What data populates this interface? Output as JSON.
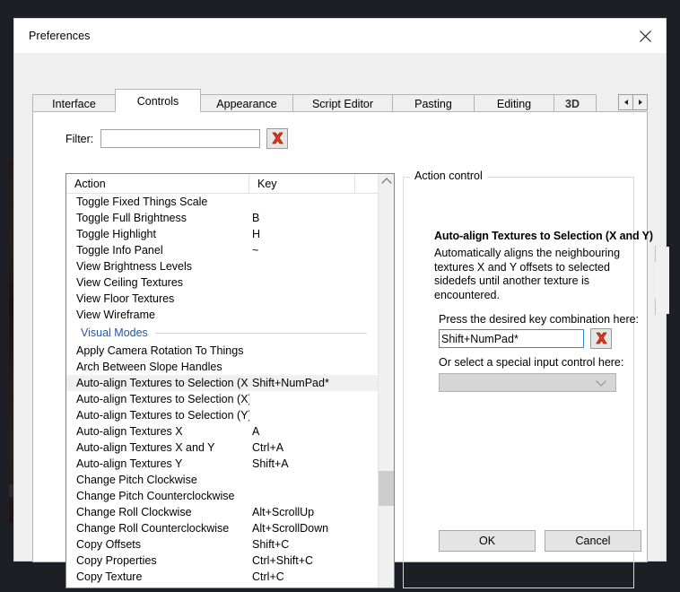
{
  "window": {
    "title": "Preferences",
    "close_icon": "close-x-icon"
  },
  "tabs": [
    {
      "label": "Interface",
      "active": false
    },
    {
      "label": "Controls",
      "active": true
    },
    {
      "label": "Appearance",
      "active": false
    },
    {
      "label": "Script Editor",
      "active": false
    },
    {
      "label": "Pasting",
      "active": false
    },
    {
      "label": "Editing",
      "active": false
    },
    {
      "label": "3D",
      "active": false
    }
  ],
  "tab_nav": {
    "prev_icon": "triangle-left-icon",
    "next_icon": "triangle-right-icon"
  },
  "filter": {
    "label": "Filter:",
    "value": "",
    "placeholder": "",
    "clear_icon": "red-x-clear-icon"
  },
  "list": {
    "columns": [
      "Action",
      "Key"
    ],
    "rows": [
      {
        "action": "Toggle Fixed Things Scale",
        "key": "",
        "type": "item",
        "selected": false
      },
      {
        "action": "Toggle Full Brightness",
        "key": "B",
        "type": "item",
        "selected": false
      },
      {
        "action": "Toggle Highlight",
        "key": "H",
        "type": "item",
        "selected": false
      },
      {
        "action": "Toggle Info Panel",
        "key": "~",
        "type": "item",
        "selected": false
      },
      {
        "action": "View Brightness Levels",
        "key": "",
        "type": "item",
        "selected": false
      },
      {
        "action": "View Ceiling Textures",
        "key": "",
        "type": "item",
        "selected": false
      },
      {
        "action": "View Floor Textures",
        "key": "",
        "type": "item",
        "selected": false
      },
      {
        "action": "View Wireframe",
        "key": "",
        "type": "item",
        "selected": false
      },
      {
        "action": "Visual Modes",
        "key": "",
        "type": "group",
        "selected": false
      },
      {
        "action": "Apply Camera Rotation To Things",
        "key": "",
        "type": "item",
        "selected": false
      },
      {
        "action": "Arch Between Slope Handles",
        "key": "",
        "type": "item",
        "selected": false
      },
      {
        "action": "Auto-align Textures to Selection (X an...",
        "key": "Shift+NumPad*",
        "type": "item",
        "selected": true
      },
      {
        "action": "Auto-align Textures to Selection (X)",
        "key": "",
        "type": "item",
        "selected": false
      },
      {
        "action": "Auto-align Textures to Selection (Y)",
        "key": "",
        "type": "item",
        "selected": false
      },
      {
        "action": "Auto-align Textures X",
        "key": "A",
        "type": "item",
        "selected": false
      },
      {
        "action": "Auto-align Textures X and Y",
        "key": "Ctrl+A",
        "type": "item",
        "selected": false
      },
      {
        "action": "Auto-align Textures Y",
        "key": "Shift+A",
        "type": "item",
        "selected": false
      },
      {
        "action": "Change Pitch Clockwise",
        "key": "",
        "type": "item",
        "selected": false
      },
      {
        "action": "Change Pitch Counterclockwise",
        "key": "",
        "type": "item",
        "selected": false
      },
      {
        "action": "Change Roll Clockwise",
        "key": "Alt+ScrollUp",
        "type": "item",
        "selected": false
      },
      {
        "action": "Change Roll Counterclockwise",
        "key": "Alt+ScrollDown",
        "type": "item",
        "selected": false
      },
      {
        "action": "Copy Offsets",
        "key": "Shift+C",
        "type": "item",
        "selected": false
      },
      {
        "action": "Copy Properties",
        "key": "Ctrl+Shift+C",
        "type": "item",
        "selected": false
      },
      {
        "action": "Copy Texture",
        "key": "Ctrl+C",
        "type": "item",
        "selected": false
      }
    ],
    "scroll_up_icon": "chevron-up-icon",
    "scroll_down_icon": "chevron-down-icon"
  },
  "action_control": {
    "group_title": "Action control",
    "heading": "Auto-align Textures to Selection (X and Y)",
    "description": "Automatically aligns the neighbouring textures X and Y offsets to selected sidedefs until another texture is encountered.",
    "press_label": "Press the desired key combination here:",
    "key_value": "Shift+NumPad*",
    "key_clear_icon": "red-x-clear-icon",
    "select_label": "Or select a special input control here:",
    "special_input_value": "",
    "special_input_icon": "chevron-down-icon",
    "desc_scroll_up_icon": "chevron-up-icon",
    "desc_scroll_down_icon": "chevron-down-icon"
  },
  "footer": {
    "ok_label": "OK",
    "cancel_label": "Cancel"
  },
  "colors": {
    "accent_focus": "#2b8ddb",
    "group_header": "#2a5699",
    "selection_bg": "#f0f0f0",
    "clear_icon_red": "#e03a20"
  }
}
